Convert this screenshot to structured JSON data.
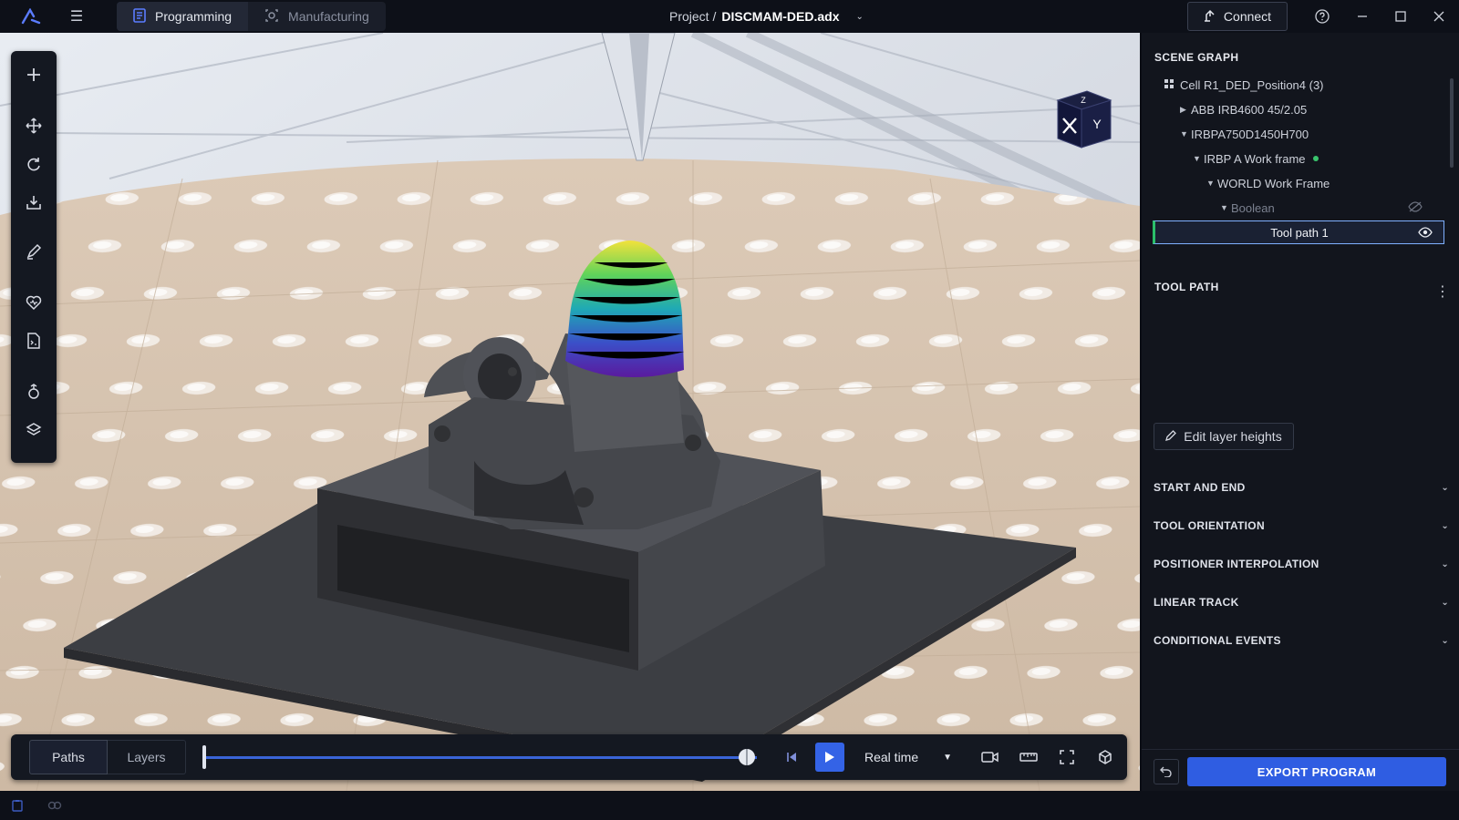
{
  "app": {
    "logo": "app-logo-icon",
    "menu_icon": "hamburger-icon"
  },
  "mode_tabs": [
    {
      "label": "Programming",
      "icon": "programming-icon",
      "active": true
    },
    {
      "label": "Manufacturing",
      "icon": "manufacturing-icon",
      "active": false
    }
  ],
  "project": {
    "prefix": "Project /",
    "name": "DISCMAM-DED.adx"
  },
  "connect_label": "Connect",
  "window_controls": [
    "help-icon",
    "minimize-icon",
    "maximize-icon",
    "close-icon"
  ],
  "left_tools": [
    "add-icon",
    "move-icon",
    "rotate-icon",
    "import-icon",
    "edit-path-icon",
    "favorite-icon",
    "document-icon",
    "weld-icon",
    "layers-icon"
  ],
  "viewcube": {
    "face_x": "X",
    "face_y": "Y",
    "face_z": "Z"
  },
  "playback": {
    "tabs": [
      "Paths",
      "Layers"
    ],
    "active_tab": "Paths",
    "progress": 1.0,
    "speed": "Real time"
  },
  "scene_graph": {
    "title": "SCENE GRAPH",
    "items": [
      {
        "label": "Cell R1_DED_Position4 (3)",
        "depth": 0,
        "arrow": "",
        "icon": "cell-icon"
      },
      {
        "label": "ABB IRB4600 45/2.05",
        "depth": 1,
        "arrow": "▶"
      },
      {
        "label": "IRBPA750D1450H700",
        "depth": 1,
        "arrow": "▼"
      },
      {
        "label": "IRBP A Work frame",
        "depth": 2,
        "arrow": "▼",
        "status": "active"
      },
      {
        "label": "WORLD Work Frame",
        "depth": 3,
        "arrow": "▼"
      },
      {
        "label": "Boolean",
        "depth": 4,
        "arrow": "▼",
        "hidden": true
      },
      {
        "label": "Tool path 1",
        "depth": 5,
        "selected": true
      }
    ]
  },
  "tool_path": {
    "title": "TOOL PATH",
    "edit_button": "Edit layer heights",
    "sections": [
      "START AND END",
      "TOOL ORIENTATION",
      "POSITIONER INTERPOLATION",
      "LINEAR TRACK",
      "CONDITIONAL EVENTS"
    ]
  },
  "export_label": "EXPORT PROGRAM",
  "colors": {
    "accent": "#2f5de2",
    "selection": "#7fb0ff",
    "active_dot": "#39c46c",
    "panel_bg": "#12151d",
    "floor": "#d2c2b2"
  }
}
